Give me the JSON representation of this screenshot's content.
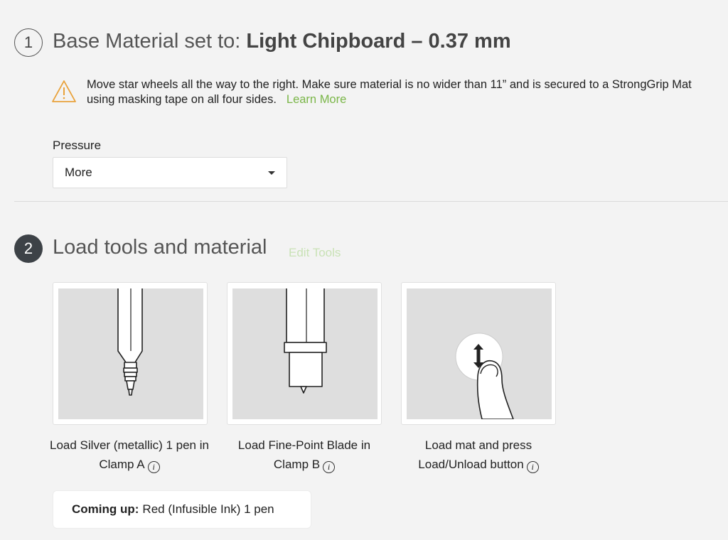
{
  "step1": {
    "number": "1",
    "title_prefix": "Base Material set to: ",
    "title_material": "Light Chipboard – 0.37 mm",
    "warning_text": "Move star wheels all the way to the right. Make sure material is no wider than 11” and is secured to a StrongGrip Mat using masking tape on all four sides.",
    "learn_more": "Learn More",
    "pressure_label": "Pressure",
    "pressure_value": "More"
  },
  "step2": {
    "number": "2",
    "title": "Load tools and material",
    "edit_tools": "Edit Tools",
    "cards": [
      {
        "caption": "Load Silver (metallic) 1 pen in Clamp A",
        "icon": "pen-illustration"
      },
      {
        "caption": "Load Fine-Point Blade in Clamp B",
        "icon": "blade-illustration"
      },
      {
        "caption": "Load mat and press Load/Unload button",
        "icon": "finger-press-illustration"
      }
    ],
    "info_glyph": "i",
    "coming_up_label": "Coming up:",
    "coming_up_value": "Red (Infusible Ink) 1 pen"
  },
  "colors": {
    "accent_green": "#7ab648",
    "edit_tools_disabled": "#c9e2b6",
    "warning_orange": "#e9a23b",
    "step_badge_dark": "#3d4247"
  }
}
